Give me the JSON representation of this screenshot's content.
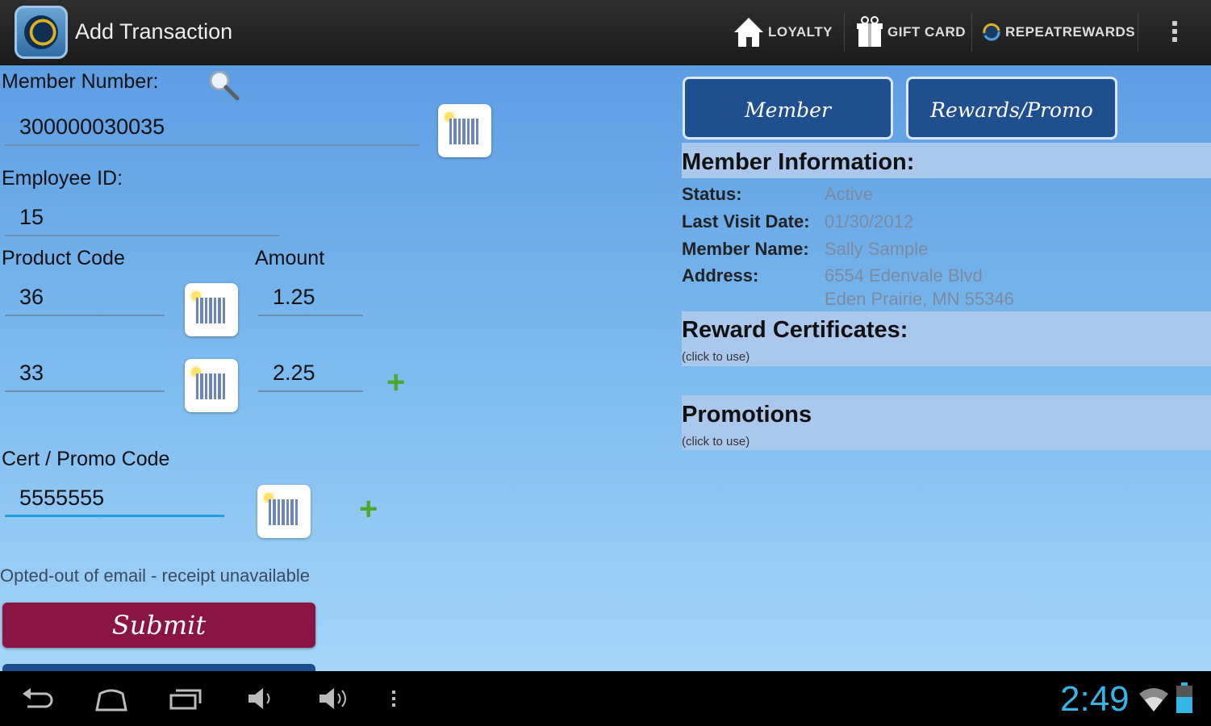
{
  "actionbar": {
    "title": "Add Transaction",
    "actions": [
      {
        "label": "LOYALTY",
        "icon": "home-icon"
      },
      {
        "label": "GIFT CARD",
        "icon": "gift-icon"
      },
      {
        "label": "REPEATREWARDS",
        "icon": "repeatrewards-logo-icon"
      }
    ],
    "overflow_icon": "overflow-menu-icon"
  },
  "form": {
    "member_number_label": "Member Number:",
    "member_number_value": "300000030035",
    "employee_id_label": "Employee ID:",
    "employee_id_value": "15",
    "product_code_label": "Product Code",
    "amount_label": "Amount",
    "lines": [
      {
        "product_code": "36",
        "amount": "1.25"
      },
      {
        "product_code": "33",
        "amount": "2.25"
      }
    ],
    "cert_label": "Cert / Promo Code",
    "cert_value": "5555555",
    "note": "Opted-out of email - receipt unavailable",
    "submit_label": "Submit"
  },
  "details": {
    "tabs": [
      "Member",
      "Rewards/Promo"
    ],
    "member_info_title": "Member Information:",
    "status_label": "Status:",
    "status_value": "Active",
    "last_visit_label": "Last Visit Date:",
    "last_visit_value": "01/30/2012",
    "name_label": "Member Name:",
    "name_value": "Sally Sample",
    "address_label": "Address:",
    "address_line1": "6554 Edenvale Blvd",
    "address_line2": "Eden Prairie, MN  55346",
    "rewards_title": "Reward Certificates:",
    "rewards_hint": "(click to use)",
    "promotions_title": "Promotions",
    "promotions_hint": "(click to use)"
  },
  "navbar": {
    "time": "2:49"
  },
  "colors": {
    "submit": "#8a1545",
    "tab": "#1f4f8e",
    "clock": "#33b5e5",
    "plus": "#4caa2a"
  }
}
